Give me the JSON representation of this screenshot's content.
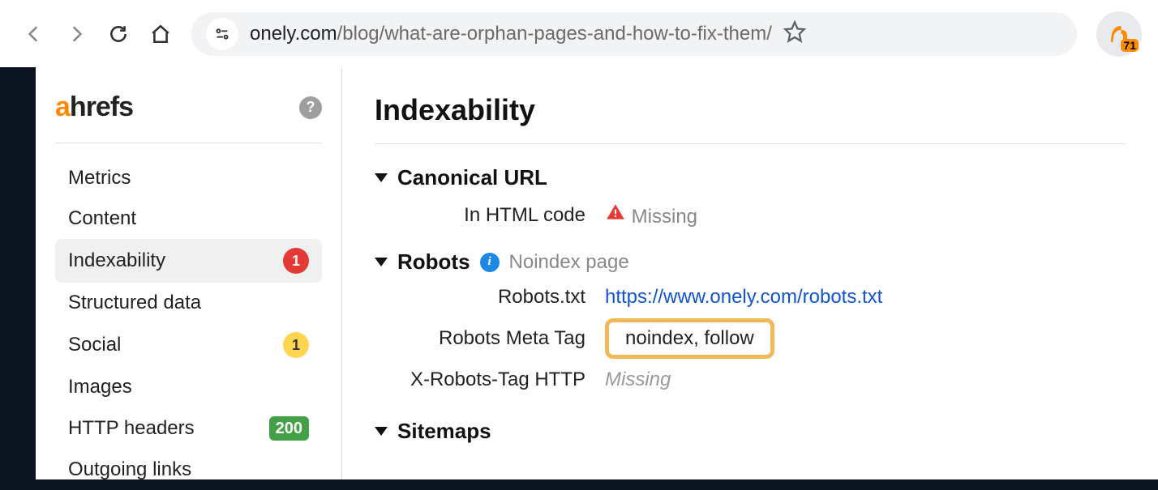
{
  "browser": {
    "url_host": "onely.com",
    "url_path": "/blog/what-are-orphan-pages-and-how-to-fix-them/",
    "ext_badge": "71"
  },
  "sidebar": {
    "items": [
      {
        "label": "Metrics",
        "badge": null
      },
      {
        "label": "Content",
        "badge": null
      },
      {
        "label": "Indexability",
        "badge": "1",
        "badge_color": "red",
        "active": true
      },
      {
        "label": "Structured data",
        "badge": null
      },
      {
        "label": "Social",
        "badge": "1",
        "badge_color": "yellow"
      },
      {
        "label": "Images",
        "badge": null
      },
      {
        "label": "HTTP headers",
        "badge": "200",
        "badge_color": "green"
      },
      {
        "label": "Outgoing links",
        "badge": null
      }
    ]
  },
  "content": {
    "title": "Indexability",
    "sections": {
      "canonical": {
        "title": "Canonical URL",
        "html_label": "In HTML code",
        "html_value": "Missing"
      },
      "robots": {
        "title": "Robots",
        "note": "Noindex page",
        "robots_txt_label": "Robots.txt",
        "robots_txt_value": "https://www.onely.com/robots.txt",
        "meta_label": "Robots Meta Tag",
        "meta_value": "noindex, follow",
        "xrobots_label": "X-Robots-Tag HTTP",
        "xrobots_value": "Missing"
      },
      "sitemaps": {
        "title": "Sitemaps"
      }
    }
  }
}
